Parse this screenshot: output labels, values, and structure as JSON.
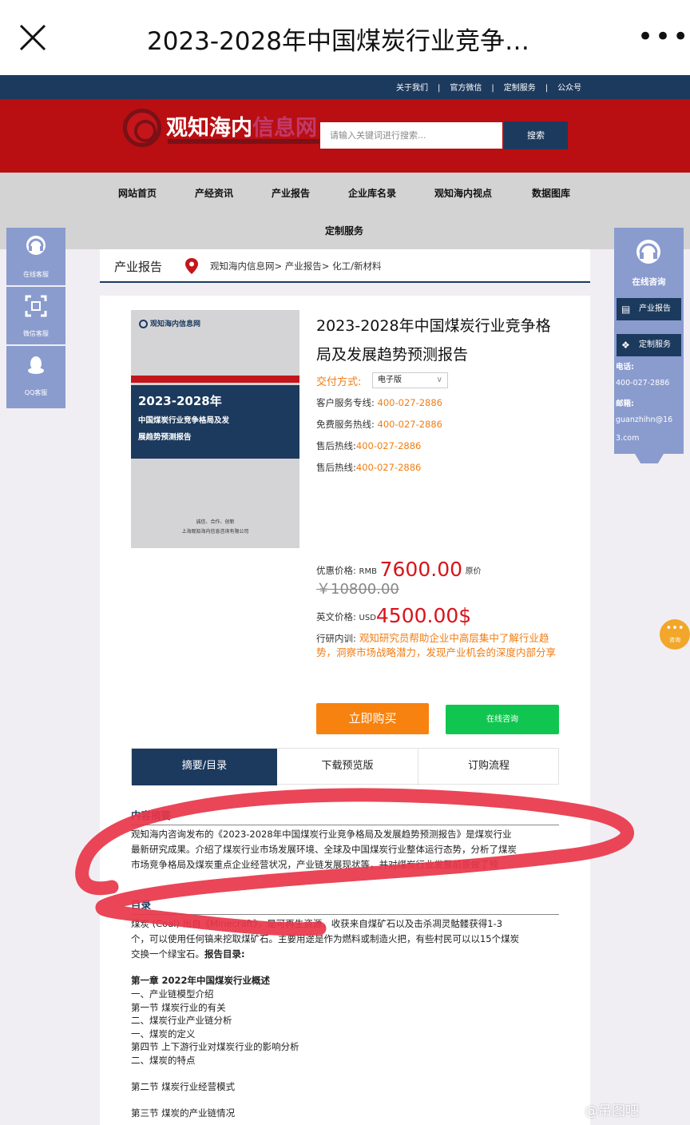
{
  "wechat": {
    "title": "2023-2028年中国煤炭行业竞争…",
    "more": "•••"
  },
  "utility": {
    "links": [
      "关于我们",
      "官方微信",
      "定制服务",
      "公众号"
    ],
    "sep": "|"
  },
  "header": {
    "logo_main": "观知海内",
    "logo_accent": "信息网",
    "search_placeholder": "请输入关键词进行搜索...",
    "search_button": "搜索"
  },
  "nav": {
    "items": [
      "网站首页",
      "产经资讯",
      "产业报告",
      "企业库名录",
      "观知海内视点",
      "数据图库",
      "定制服务"
    ]
  },
  "crumb": {
    "category": "产业报告",
    "path": "观知海内信息网> 产业报告> 化工/新材料"
  },
  "cover": {
    "logo": "观知海内信息网",
    "year": "2023-2028年",
    "line1": "中国煤炭行业竞争格局及发",
    "line2": "展趋势预测报告",
    "motto": "诚信、合作、创新",
    "company": "上海观知海内信息咨询有限公司"
  },
  "product": {
    "title": "2023-2028年中国煤炭行业竞争格局及发展趋势预测报告",
    "delivery_label": "交付方式:",
    "delivery_value": "电子版",
    "lines": [
      {
        "label": "客户服务专线:",
        "value": "400-027-2886"
      },
      {
        "label": "免费服务热线:",
        "value": "400-027-2886"
      },
      {
        "label": "售后热线:",
        "value": "400-027-2886"
      },
      {
        "label": "售后热线:",
        "value": "400-027-2886"
      }
    ],
    "price_label": "优惠价格:",
    "price_currency": "RMB",
    "price_value": "7600.00",
    "original_label": "原价",
    "original_price": "￥10800.00",
    "en_label": "英文价格:",
    "en_currency": "USD",
    "en_value": "4500.00$",
    "training_label": "行研内训:",
    "training_text": "观知研究员帮助企业中高层集中了解行业趋势，洞察市场战略潜力，发现产业机会的深度内部分享",
    "buy_button": "立即购买",
    "consult_button": "在线咨询"
  },
  "tabs": [
    "摘要/目录",
    "下载预览版",
    "订购流程"
  ],
  "summary": {
    "title": "内容摘要",
    "lines": [
      "观知海内咨询发布的《2023-2028年中国煤炭行业竞争格局及发展趋势预测报告》是煤炭行业",
      "最新研究成果。介绍了煤炭行业市场发展环境、全球及中国煤炭行业整体运行态势，分析了煤炭",
      "市场竞争格局及煤炭重点企业经营状况，产业链发展现状等，并对煤炭行业发展前景做了预"
    ]
  },
  "toc": {
    "title": "目录",
    "intro_lines": [
      "煤炭 (Coal) 出自《Minecraft》，是可再生资源，收获来自煤矿石以及击杀凋灵骷髅获得1-3",
      "个，可以使用任何镐来挖取煤矿石。主要用途是作为燃料或制造火把，有些村民可以以15个煤炭"
    ],
    "intro_last": "交换一个绿宝石。",
    "report_toc_label": "报告目录:",
    "items": [
      "第一章 2022年中国煤炭行业概述",
      "第一节 煤炭行业的有关",
      "一、煤炭的定义",
      "二、煤炭的特点",
      "第二节 煤炭行业经营模式",
      "第三节 煤炭的产业链情况",
      "一、产业链模型介绍",
      "二、煤炭行业产业链分析",
      "第四节 上下游行业对煤炭行业的影响分析"
    ]
  },
  "side_left": [
    "在线客服",
    "微信客服",
    "QQ客服"
  ],
  "side_right": {
    "heading": "在线咨询",
    "buttons": [
      "产业报告",
      "定制服务"
    ],
    "phone_label": "电话:",
    "phone": "400-027-2886",
    "email_label": "邮箱:",
    "email_1": "guanzhihn@16",
    "email_2": "3.com"
  },
  "float_consult": "咨询",
  "watermark": "@吊图吧",
  "colors": {
    "navy": "#1c3a5e",
    "red": "#b90e12",
    "orange": "#f07d14",
    "green": "#11c650",
    "side": "#8a9bce",
    "scribble": "#e8364a"
  }
}
